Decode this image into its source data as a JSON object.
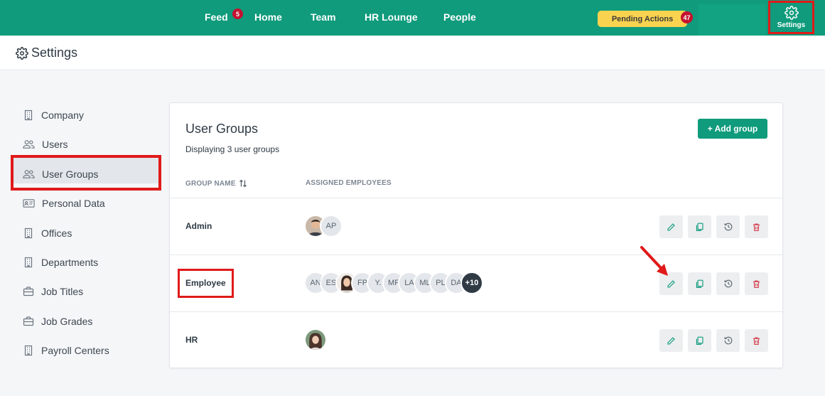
{
  "nav": {
    "items": [
      {
        "label": "Feed",
        "badge": "5"
      },
      {
        "label": "Home"
      },
      {
        "label": "Team"
      },
      {
        "label": "HR Lounge"
      },
      {
        "label": "People"
      }
    ],
    "pending_actions_label": "Pending Actions",
    "pending_actions_count": "47",
    "settings_label": "Settings"
  },
  "page": {
    "title": "Settings"
  },
  "sidebar": {
    "items": [
      {
        "label": "Company",
        "icon": "building-icon"
      },
      {
        "label": "Users",
        "icon": "users-icon"
      },
      {
        "label": "User Groups",
        "icon": "users-icon",
        "active": true
      },
      {
        "label": "Personal Data",
        "icon": "id-card-icon"
      },
      {
        "label": "Offices",
        "icon": "building-icon"
      },
      {
        "label": "Departments",
        "icon": "building-icon"
      },
      {
        "label": "Job Titles",
        "icon": "briefcase-icon"
      },
      {
        "label": "Job Grades",
        "icon": "briefcase-icon"
      },
      {
        "label": "Payroll Centers",
        "icon": "building-icon"
      }
    ]
  },
  "groups": {
    "title": "User Groups",
    "subtitle": "Displaying 3 user groups",
    "add_label": "+ Add group",
    "col_name": "GROUP NAME",
    "col_assigned": "ASSIGNED EMPLOYEES",
    "rows": [
      {
        "name": "Admin",
        "avatars": [
          "photo-male",
          "AP"
        ]
      },
      {
        "name": "Employee",
        "avatars": [
          "AN",
          "ES",
          "photo-female",
          "FP",
          "Y.",
          "MF",
          "LA",
          "ML",
          "PL",
          "DA",
          "+10"
        ]
      },
      {
        "name": "HR",
        "avatars": [
          "photo-female-2"
        ]
      }
    ]
  },
  "colors": {
    "brand": "#0f9b7c",
    "highlight": "#e01a1a",
    "pending": "#f9d34f"
  }
}
